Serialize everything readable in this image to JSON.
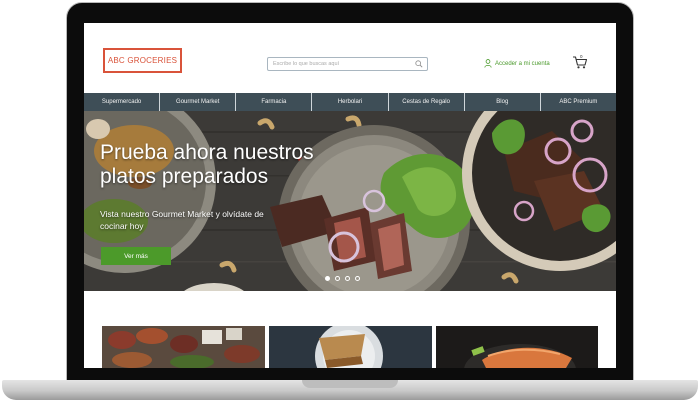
{
  "header": {
    "logo_text": "ABC GROCERIES",
    "search_placeholder": "Escribe lo que buscas aquí",
    "account_label": "Acceder a mi cuenta",
    "cart_count": "0"
  },
  "nav": {
    "items": [
      {
        "label": "Supermercado"
      },
      {
        "label": "Gourmet Market"
      },
      {
        "label": "Farmacia"
      },
      {
        "label": "Herbolari"
      },
      {
        "label": "Cestas de Regalo"
      },
      {
        "label": "Blog"
      },
      {
        "label": "ABC Premium"
      }
    ]
  },
  "hero": {
    "title": "Prueba ahora nuestros platos preparados",
    "subtitle": "Vista nuestro Gourmet Market y olvídate de cocinar hoy",
    "cta_label": "Ver más",
    "slide_count": 4,
    "active_slide": 1
  },
  "colors": {
    "brand": "#d9533a",
    "accent_green": "#4c9a2a",
    "nav_bg": "#3e4e57"
  }
}
